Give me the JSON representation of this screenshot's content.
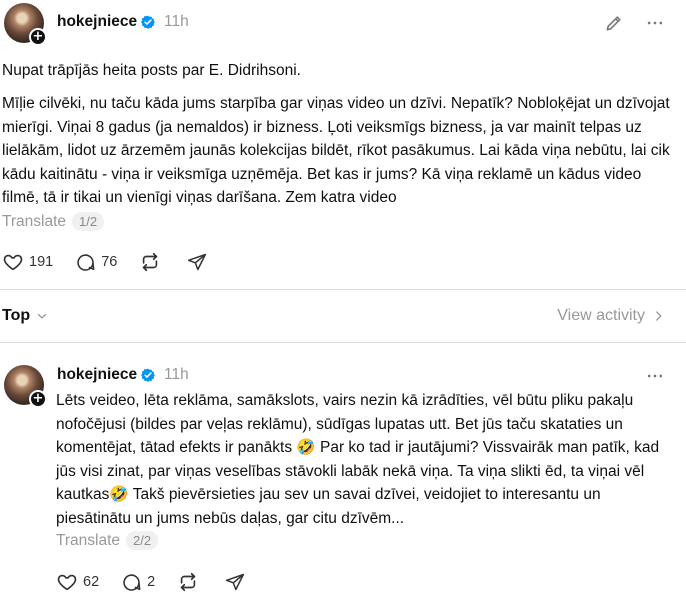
{
  "post": {
    "username": "hokejniece",
    "time": "11h",
    "paragraph1": "Nupat trāpījās heita posts par E. Didrihsoni.",
    "paragraph2": "Mīļie cilvēki, nu taču kāda jums starpība gar viņas video un dzīvi. Nepatīk? Nobloķējat un dzīvojat mierīgi. Viņai 8 gadus (ja nemaldos) ir bizness. Ļoti veiksmīgs bizness, ja var mainīt telpas uz lielākām, lidot uz ārzemēm jaunās kolekcijas bildēt, rīkot pasākumus. Lai kāda viņa nebūtu, lai cik kādu kaitinātu - viņa ir veiksmīga uzņēmēja. Bet kas ir jums? Kā viņa reklamē un kādus video filmē, tā ir tikai un vienīgi viņas darīšana. Zem katra video",
    "translate_label": "Translate",
    "pager": "1/2",
    "likes": "191",
    "comments": "76",
    "icons": [
      "pencil-icon",
      "more-icon",
      "heart-icon",
      "comment-icon",
      "repost-icon",
      "share-icon"
    ]
  },
  "sort": {
    "label": "Top",
    "view_activity": "View activity"
  },
  "reply": {
    "username": "hokejniece",
    "time": "11h",
    "text": "Lēts veideo, lēta reklāma, samākslots, vairs nezin kā izrādīties, vēl būtu pliku pakaļu nofočējusi (bildes par veļas reklāmu), sūdīgas lupatas utt. Bet jūs taču skataties un komentējat, tātad efekts ir panākts 🤣 Par ko tad ir jautājumi? Vissvairāk man patīk, kad jūs visi zinat, par viņas veselības stāvokli labāk nekā viņa. Ta viņa slikti ēd, ta viņai vēl kautkas🤣 Takš pievērsieties jau sev un savai dzīvei, veidojiet to interesantu un piesātinātu un jums nebūs daļas, gar citu dzīvēm...",
    "translate_label": "Translate",
    "pager": "2/2",
    "likes": "62",
    "comments": "2"
  },
  "colors": {
    "verified": "#0095f6",
    "muted": "#999999",
    "text": "#101010"
  }
}
